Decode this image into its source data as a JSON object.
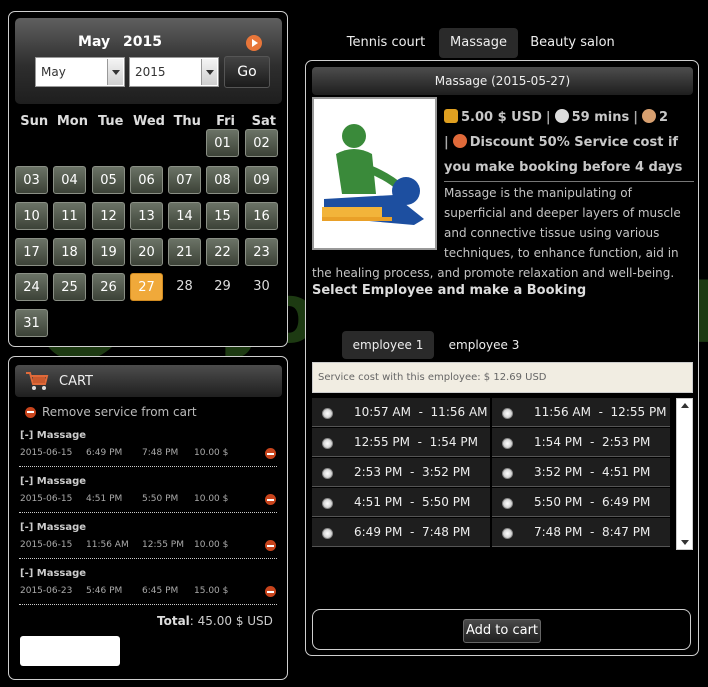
{
  "calendar": {
    "month": "May",
    "year": "2015",
    "month_select": "May",
    "year_select": "2015",
    "go_label": "Go",
    "weekdays": [
      "Sun",
      "Mon",
      "Tue",
      "Wed",
      "Thu",
      "Fri",
      "Sat"
    ],
    "days": [
      {
        "label": "01",
        "state": "available"
      },
      {
        "label": "02",
        "state": "available"
      },
      {
        "label": "03",
        "state": "available"
      },
      {
        "label": "04",
        "state": "available"
      },
      {
        "label": "05",
        "state": "available"
      },
      {
        "label": "06",
        "state": "available"
      },
      {
        "label": "07",
        "state": "available"
      },
      {
        "label": "08",
        "state": "available"
      },
      {
        "label": "09",
        "state": "available"
      },
      {
        "label": "10",
        "state": "available"
      },
      {
        "label": "11",
        "state": "available"
      },
      {
        "label": "12",
        "state": "available"
      },
      {
        "label": "13",
        "state": "available"
      },
      {
        "label": "14",
        "state": "available"
      },
      {
        "label": "15",
        "state": "available"
      },
      {
        "label": "16",
        "state": "available"
      },
      {
        "label": "17",
        "state": "available"
      },
      {
        "label": "18",
        "state": "available"
      },
      {
        "label": "19",
        "state": "available"
      },
      {
        "label": "20",
        "state": "available"
      },
      {
        "label": "21",
        "state": "available"
      },
      {
        "label": "22",
        "state": "available"
      },
      {
        "label": "23",
        "state": "available"
      },
      {
        "label": "24",
        "state": "available"
      },
      {
        "label": "25",
        "state": "available"
      },
      {
        "label": "26",
        "state": "available"
      },
      {
        "label": "27",
        "state": "selected"
      },
      {
        "label": "28",
        "state": "unavailable"
      },
      {
        "label": "29",
        "state": "unavailable"
      },
      {
        "label": "30",
        "state": "unavailable"
      },
      {
        "label": "31",
        "state": "available"
      }
    ]
  },
  "cart": {
    "title": "CART",
    "remove_label": "Remove service from cart",
    "items": [
      {
        "name": "[-] Massage",
        "date": "2015-06-15",
        "start": "6:49 PM",
        "end": "7:48 PM",
        "price": "10.00 $"
      },
      {
        "name": "[-] Massage",
        "date": "2015-06-15",
        "start": "4:51 PM",
        "end": "5:50 PM",
        "price": "10.00 $"
      },
      {
        "name": "[-] Massage",
        "date": "2015-06-15",
        "start": "11:56 AM",
        "end": "12:55 PM",
        "price": "10.00 $"
      },
      {
        "name": "[-] Massage",
        "date": "2015-06-23",
        "start": "5:46 PM",
        "end": "6:45 PM",
        "price": "15.00 $"
      }
    ],
    "total_label": "Total",
    "total_value": ": 45.00 $ USD"
  },
  "tabs": [
    {
      "label": "Tennis court",
      "active": false
    },
    {
      "label": "Massage",
      "active": true
    },
    {
      "label": "Beauty salon",
      "active": false
    }
  ],
  "service": {
    "header": "Massage (2015-05-27)",
    "price": "5.00 $ USD",
    "duration": "59 mins",
    "capacity": "2",
    "discount": "Discount 50% Service cost if you make booking before 4 days",
    "description_lines": [
      "Massage is the manipulating of",
      "superficial and deeper layers of muscle",
      "and connective tissue using various",
      "techniques, to enhance function, aid in",
      "the healing process, and promote relaxation and well-being."
    ],
    "select_employee": "Select Employee and make a Booking"
  },
  "employees": [
    {
      "label": "employee 1",
      "active": true
    },
    {
      "label": "employee 3",
      "active": false
    }
  ],
  "cost_note": "Service cost with this employee: $ 12.69 USD",
  "slots": [
    [
      "10:57 AM  -  11:56 AM",
      "11:56 AM  -  12:55 PM"
    ],
    [
      "12:55 PM  -  1:54 PM",
      "1:54 PM  -  2:53 PM"
    ],
    [
      "2:53 PM  -  3:52 PM",
      "3:52 PM  -  4:51 PM"
    ],
    [
      "4:51 PM  -  5:50 PM",
      "5:50 PM  -  6:49 PM"
    ],
    [
      "6:49 PM  -  7:48 PM",
      "7:48 PM  -  8:47 PM"
    ]
  ],
  "add_to_cart": "Add to cart",
  "watermark": "Joomla.bid",
  "colors": {
    "accent": "#f0a93a",
    "remove": "#c8441c",
    "watermark": "#1d3a12"
  }
}
